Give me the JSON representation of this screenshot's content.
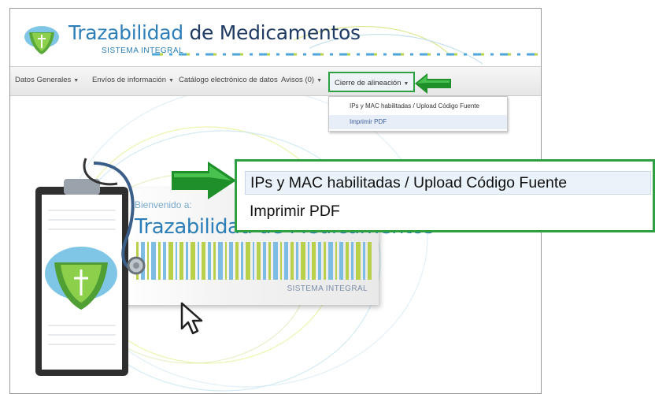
{
  "header": {
    "title_part1": "Trazabilidad",
    "title_part2": "de Medicamentos",
    "subtitle": "SISTEMA INTEGRAL"
  },
  "menu": {
    "items": [
      {
        "label": "Datos Generales"
      },
      {
        "label": "Envíos de información"
      },
      {
        "label": "Catálogo electrónico de datos"
      },
      {
        "label": "Avisos (0)"
      }
    ],
    "active": {
      "label": "Cierre de alineación"
    }
  },
  "dropdown": {
    "items": [
      {
        "label": "IPs y MAC habilitadas / Upload Código Fuente"
      },
      {
        "label": "Imprimir PDF"
      }
    ]
  },
  "zoom": {
    "items": [
      {
        "label": "IPs y MAC habilitadas / Upload Código Fuente"
      },
      {
        "label": "Imprimir PDF"
      }
    ]
  },
  "banner": {
    "welcome": "Bienvenido a:",
    "title": "Trazabilidad de Medicamentos",
    "subtitle": "SISTEMA INTEGRAL"
  },
  "colors": {
    "highlight_green": "#2ea043",
    "brand_blue": "#2c7fb8",
    "brand_dark": "#1f3b63"
  }
}
